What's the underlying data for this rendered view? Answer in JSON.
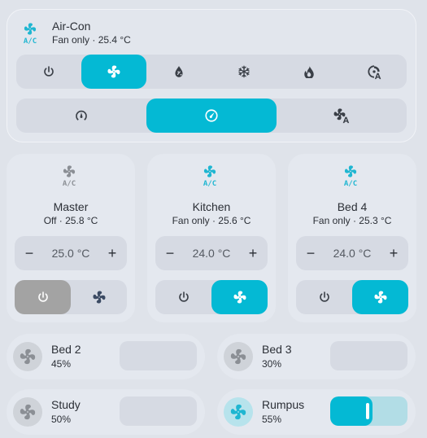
{
  "main": {
    "icon": "ac-icon",
    "title": "Air-Con",
    "status": "Fan only · 25.4 °C",
    "modes": [
      {
        "icon": "power-icon",
        "active": false
      },
      {
        "icon": "fan-icon",
        "active": true
      },
      {
        "icon": "dry-icon",
        "active": false
      },
      {
        "icon": "snowflake-icon",
        "active": false
      },
      {
        "icon": "flame-icon",
        "active": false
      },
      {
        "icon": "auto-mode-icon",
        "active": false
      }
    ],
    "fan_speeds": [
      {
        "icon": "fan-low-icon",
        "active": false
      },
      {
        "icon": "fan-medium-icon",
        "active": true
      },
      {
        "icon": "fan-auto-icon",
        "active": false
      }
    ]
  },
  "rooms": [
    {
      "name": "Master",
      "status": "Off · 25.8 °C",
      "setpoint": "25.0 °C",
      "minus": "−",
      "plus": "+",
      "state": "off"
    },
    {
      "name": "Kitchen",
      "status": "Fan only · 25.6 °C",
      "setpoint": "24.0 °C",
      "minus": "−",
      "plus": "+",
      "state": "fan"
    },
    {
      "name": "Bed 4",
      "status": "Fan only · 25.3 °C",
      "setpoint": "24.0 °C",
      "minus": "−",
      "plus": "+",
      "state": "fan"
    }
  ],
  "zones": [
    {
      "name": "Bed 2",
      "percent": "45%",
      "level": 0.45,
      "on": false
    },
    {
      "name": "Bed 3",
      "percent": "30%",
      "level": 0.3,
      "on": false
    },
    {
      "name": "Study",
      "percent": "50%",
      "level": 0.5,
      "on": false
    },
    {
      "name": "Rumpus",
      "percent": "55%",
      "level": 0.55,
      "on": true
    }
  ],
  "colors": {
    "accent": "#04b9d4",
    "off": "#a3a3a3",
    "background": "#dfe3ea"
  }
}
